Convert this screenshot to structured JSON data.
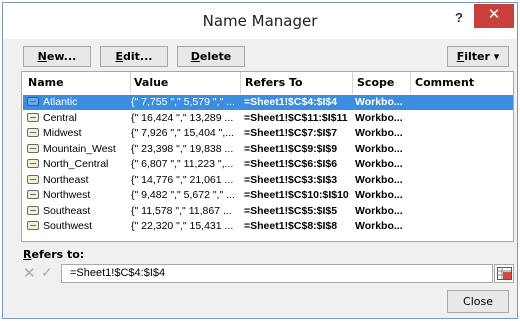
{
  "window": {
    "title": "Name Manager",
    "help": "?",
    "close": "✕"
  },
  "toolbar": {
    "new_label": "New...",
    "new_key": "N",
    "new_rest": "ew...",
    "edit_key": "E",
    "edit_rest": "dit...",
    "delete_key": "D",
    "delete_rest": "elete",
    "filter_key": "F",
    "filter_rest": "ilter ▾"
  },
  "columns": [
    "Name",
    "Value",
    "Refers To",
    "Scope",
    "Comment"
  ],
  "rows": [
    {
      "name": "Atlantic",
      "value": "{\" 7,755 \",\" 5,579 \",\" ...",
      "refers_to": "=Sheet1!$C$4:$I$4",
      "scope": "Workbo...",
      "selected": true
    },
    {
      "name": "Central",
      "value": "{\" 16,424 \",\" 13,289 ...",
      "refers_to": "=Sheet1!$C$11:$I$11",
      "scope": "Workbo..."
    },
    {
      "name": "Midwest",
      "value": "{\" 7,926 \",\" 15,404 \",...",
      "refers_to": "=Sheet1!$C$7:$I$7",
      "scope": "Workbo..."
    },
    {
      "name": "Mountain_West",
      "value": "{\" 23,398 \",\" 19,838 ...",
      "refers_to": "=Sheet1!$C$9:$I$9",
      "scope": "Workbo..."
    },
    {
      "name": "North_Central",
      "value": "{\" 6,807 \",\" 11,223 \",...",
      "refers_to": "=Sheet1!$C$6:$I$6",
      "scope": "Workbo..."
    },
    {
      "name": "Northeast",
      "value": "{\" 14,776 \",\" 21,061 ...",
      "refers_to": "=Sheet1!$C$3:$I$3",
      "scope": "Workbo..."
    },
    {
      "name": "Northwest",
      "value": "{\" 9,482 \",\" 5,672 \",\" ...",
      "refers_to": "=Sheet1!$C$10:$I$10",
      "scope": "Workbo..."
    },
    {
      "name": "Southeast",
      "value": "{\" 11,578 \",\" 11,867 ...",
      "refers_to": "=Sheet1!$C$5:$I$5",
      "scope": "Workbo..."
    },
    {
      "name": "Southwest",
      "value": "{\" 22,320 \",\" 15,431 ...",
      "refers_to": "=Sheet1!$C$8:$I$8",
      "scope": "Workbo..."
    }
  ],
  "refers": {
    "label_key": "R",
    "label_rest": "efers to:",
    "value": "=Sheet1!$C$4:$I$4"
  },
  "footer": {
    "close_label": "Close"
  },
  "colors": {
    "selection": "#3b8de0",
    "close_button": "#c7403a"
  }
}
